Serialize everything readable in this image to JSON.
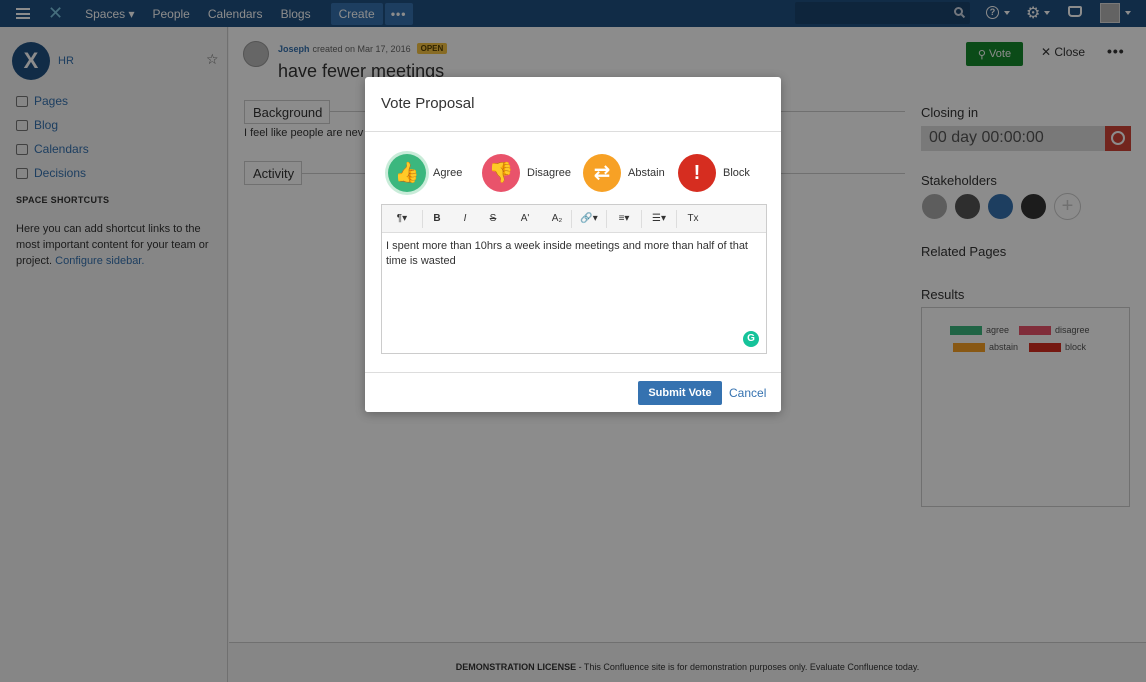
{
  "topnav": {
    "spaces": "Spaces",
    "people": "People",
    "calendars": "Calendars",
    "blogs": "Blogs",
    "create": "Create",
    "more": "•••",
    "help": "?"
  },
  "sidebar": {
    "space_name": "HR",
    "space_logo": "X",
    "items": [
      {
        "label": "Pages",
        "icon": "pages-icon"
      },
      {
        "label": "Blog",
        "icon": "blog-icon"
      },
      {
        "label": "Calendars",
        "icon": "calendar-icon"
      },
      {
        "label": "Decisions",
        "icon": "decisions-icon"
      }
    ],
    "shortcuts_heading": "SPACE SHORTCUTS",
    "shortcuts_text": "Here you can add shortcut links to the most important content for your team or project.",
    "configure_link": "Configure sidebar."
  },
  "page": {
    "author": "Joseph",
    "created": "created on Mar 17, 2016",
    "status": "OPEN",
    "title": "have fewer meetings",
    "vote_label": "Vote",
    "close_label": "Close",
    "more_label": "•••",
    "background_label": "Background",
    "background_text": "I feel like people are nev",
    "activity_label": "Activity",
    "closing_in_label": "Closing in",
    "countdown": "00 day 00:00:00",
    "stakeholders_label": "Stakeholders",
    "related_pages_label": "Related Pages",
    "results_label": "Results",
    "legend": [
      {
        "label": "agree",
        "color": "#3bb77e"
      },
      {
        "label": "disagree",
        "color": "#e9536b"
      },
      {
        "label": "abstain",
        "color": "#f7a125"
      },
      {
        "label": "block",
        "color": "#d62d20"
      }
    ]
  },
  "dialog": {
    "title": "Vote Proposal",
    "choices": [
      {
        "label": "Agree",
        "icon": "thumbs-up-icon",
        "glyph": "👍"
      },
      {
        "label": "Disagree",
        "icon": "thumbs-down-icon",
        "glyph": "👎"
      },
      {
        "label": "Abstain",
        "icon": "swap-arrows-icon",
        "glyph": "⇄"
      },
      {
        "label": "Block",
        "icon": "exclamation-icon",
        "glyph": "!"
      }
    ],
    "toolbar": [
      "¶",
      "B",
      "I",
      "S",
      "A'",
      "A₂",
      "🔗",
      "≡",
      "☰",
      "Tx"
    ],
    "comment": "I spent more than 10hrs a week inside meetings and more than half of that time is wasted",
    "submit_label": "Submit Vote",
    "cancel_label": "Cancel"
  },
  "footer": {
    "license_bold": "DEMONSTRATION LICENSE",
    "license_text": " - This Confluence site is for demonstration purposes only. Evaluate Confluence today."
  }
}
